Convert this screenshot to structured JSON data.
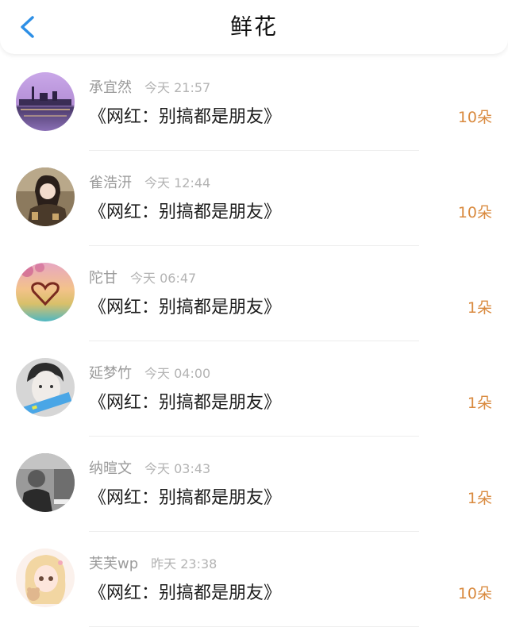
{
  "header": {
    "title": "鲜花",
    "back_icon": "chevron-left-icon",
    "accent_color": "#2d8fe6"
  },
  "colors": {
    "count": "#d98a3f",
    "name": "#9a9a9a",
    "time": "#b3b3b3"
  },
  "items": [
    {
      "name": "承宜然",
      "time": "今天 21:57",
      "work": "《网红：别搞都是朋友》",
      "count": "10朵",
      "avatar": "avatar-city-lake"
    },
    {
      "name": "雀浩汧",
      "time": "今天 12:44",
      "work": "《网红：别搞都是朋友》",
      "count": "10朵",
      "avatar": "avatar-girl-photo"
    },
    {
      "name": "陀甘",
      "time": "今天 06:47",
      "work": "《网红：别搞都是朋友》",
      "count": "1朵",
      "avatar": "avatar-heart-sunset"
    },
    {
      "name": "延梦竹",
      "time": "今天 04:00",
      "work": "《网红：别搞都是朋友》",
      "count": "1朵",
      "avatar": "avatar-boy-photo"
    },
    {
      "name": "纳暄文",
      "time": "今天 03:43",
      "work": "《网红：别搞都是朋友》",
      "count": "1朵",
      "avatar": "avatar-gray-photo"
    },
    {
      "name": "芙芙wp",
      "time": "昨天 23:38",
      "work": "《网红：别搞都是朋友》",
      "count": "10朵",
      "avatar": "avatar-anime-girl"
    }
  ]
}
